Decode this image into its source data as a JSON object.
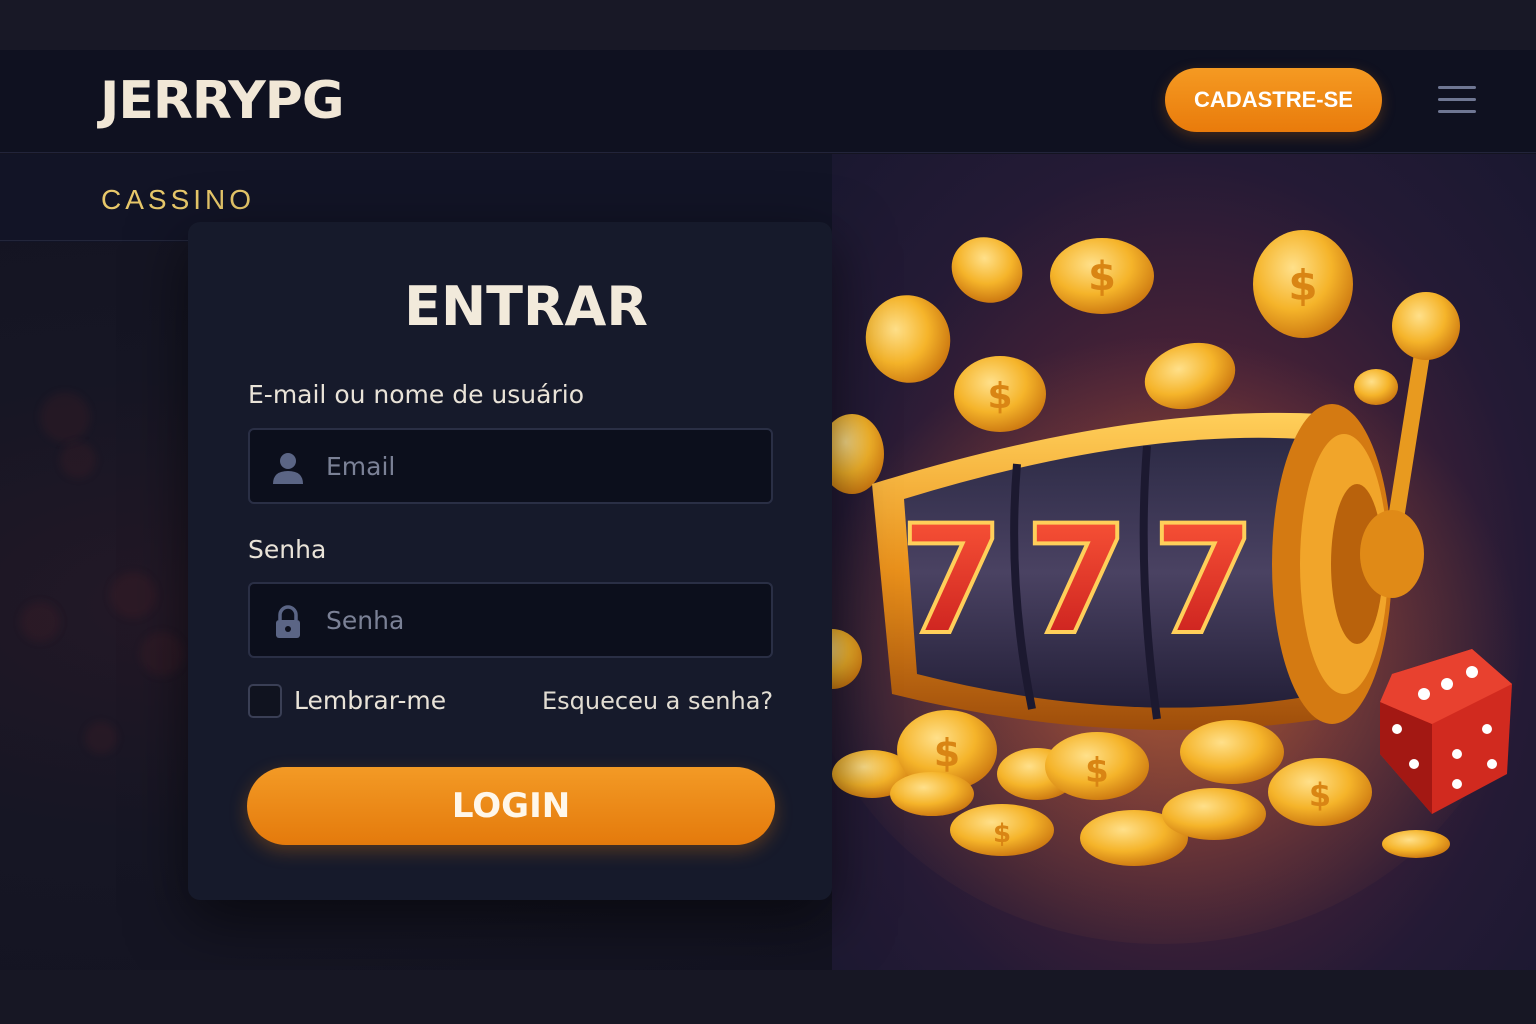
{
  "header": {
    "logo_text": "JERRYPG",
    "signup_label": "CADASTRE-SE",
    "menu_icon": "hamburger-menu-icon"
  },
  "subnav": {
    "active_tab": "CASSINO"
  },
  "login_form": {
    "title": "ENTRAR",
    "email_label": "E-mail ou nome de usuário",
    "email_placeholder": "Email",
    "email_icon": "user-icon",
    "password_label": "Senha",
    "password_placeholder": "Senha",
    "password_icon": "lock-icon",
    "remember_label": "Lembrar-me",
    "remember_checked": false,
    "forgot_label": "Esqueceu a senha?",
    "submit_label": "LOGIN"
  },
  "hero": {
    "reel_symbols": [
      "7",
      "7",
      "7"
    ],
    "coin_symbol": "$",
    "image_subject": "slot-machine-illustration"
  },
  "colors": {
    "accent_orange": "#f0901a",
    "logo_cream": "#f1e7d6",
    "tab_gold": "#e8c86a",
    "card_bg": "#161a2b",
    "page_bg": "#141421"
  }
}
